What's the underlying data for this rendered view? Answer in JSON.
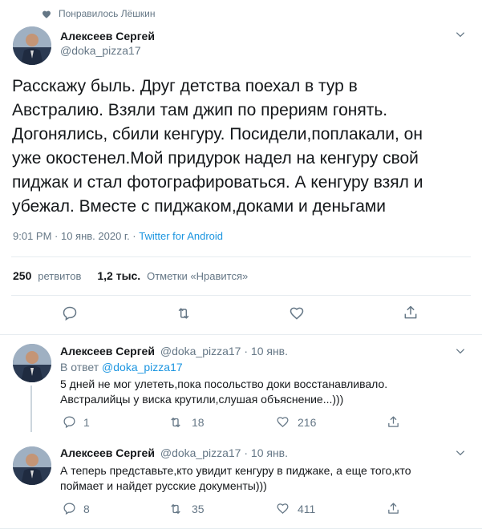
{
  "social_context": {
    "text": "Понравилось Лёшкин"
  },
  "main_tweet": {
    "author_name": "Алексеев Сергей",
    "author_handle": "@doka_pizza17",
    "lines": [
      "Расскажу быль. Друг детства поехал в тур в",
      "Австралию. Взяли там джип по прериям гонять.",
      "Догонялись, сбили кенгуру. Посидели,поплакали, он",
      "уже окостенел.Мой придурок надел на кенгуру свой",
      "пиджак и стал фотографироваться. А кенгуру взял и",
      "убежал. Вместе с пиджаком,доками и деньгами"
    ],
    "time": "9:01 PM · 10 янв. 2020 г. · ",
    "source": "Twitter for Android",
    "retweets_count": "250",
    "retweets_label": "ретвитов",
    "likes_count": "1,2 тыс.",
    "likes_label": "Отметки «Нравится»"
  },
  "replies": [
    {
      "author_name": "Алексеев Сергей",
      "handle_date": "@doka_pizza17 · 10 янв.",
      "reply_prefix": "В ответ ",
      "reply_to": "@doka_pizza17",
      "lines": [
        "5 дней не мог улететь,пока посольство доки восстанавливало.",
        "Австралийцы у виска крутили,слушая объяснение...)))"
      ],
      "replies_count": "1",
      "retweets_count": "18",
      "likes_count": "216"
    },
    {
      "author_name": "Алексеев Сергей",
      "handle_date": "@doka_pizza17 · 10 янв.",
      "lines": [
        "А теперь представьте,кто увидит кенгуру в пиджаке, а еще того,кто",
        "поймает и найдет русские документы)))"
      ],
      "replies_count": "8",
      "retweets_count": "35",
      "likes_count": "411"
    }
  ],
  "colors": {
    "accent": "#1b95e0",
    "muted": "#657786",
    "divider": "#e6ecf0"
  }
}
